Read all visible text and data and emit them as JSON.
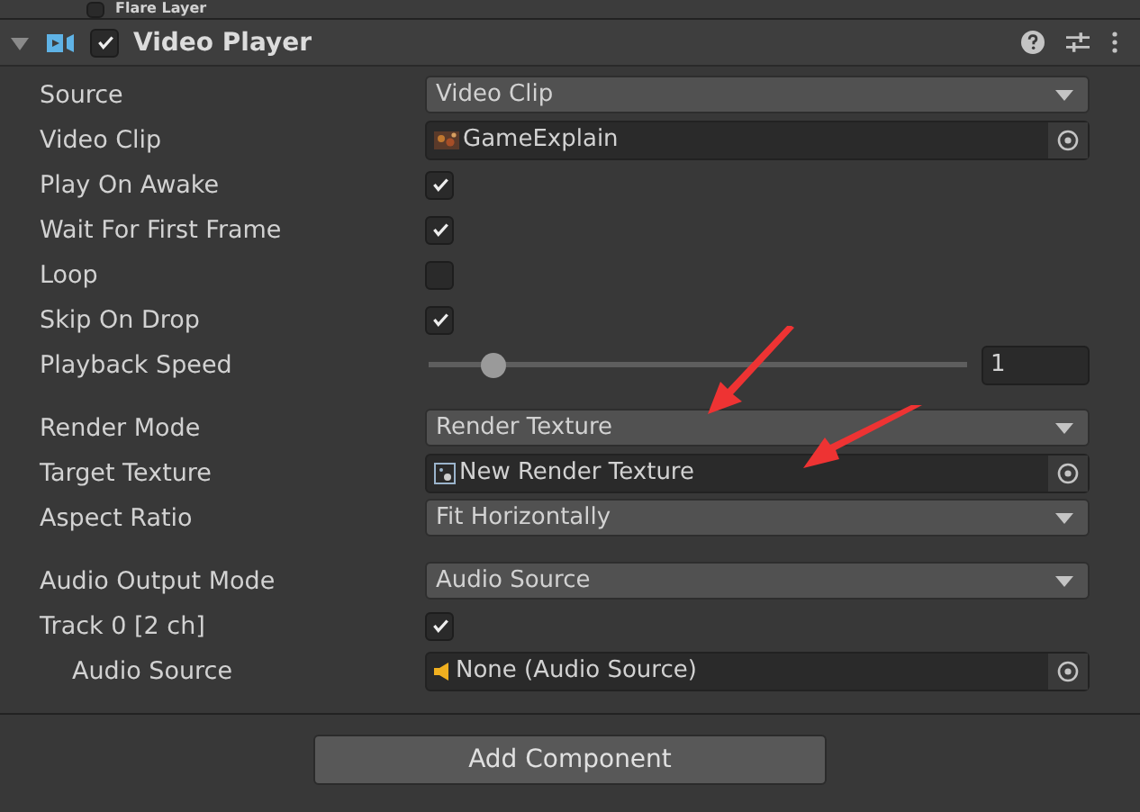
{
  "previous_component": {
    "title": "Flare Layer",
    "enabled": false
  },
  "component": {
    "title": "Video Player",
    "enabled": true,
    "expanded": true
  },
  "property_groups": [
    [
      {
        "label": "Source",
        "kind": "dropdown",
        "value": "Video Clip"
      },
      {
        "label": "Video Clip",
        "kind": "video_object",
        "value": "GameExplain"
      },
      {
        "label": "Play On Awake",
        "kind": "checkbox",
        "checked": true
      },
      {
        "label": "Wait For First Frame",
        "kind": "checkbox",
        "checked": true
      },
      {
        "label": "Loop",
        "kind": "checkbox",
        "checked": false
      },
      {
        "label": "Skip On Drop",
        "kind": "checkbox",
        "checked": true
      },
      {
        "label": "Playback Speed",
        "kind": "slider",
        "level": 0.12,
        "value": "1"
      }
    ],
    [
      {
        "label": "Render Mode",
        "kind": "dropdown",
        "value": "Render Texture"
      },
      {
        "label": "Target Texture",
        "kind": "texture_object",
        "value": "New Render Texture"
      },
      {
        "label": "Aspect Ratio",
        "kind": "dropdown",
        "value": "Fit Horizontally"
      }
    ],
    [
      {
        "label": "Audio Output Mode",
        "kind": "dropdown",
        "value": "Audio Source"
      },
      {
        "label": "Track 0 [2 ch]",
        "kind": "checkbox",
        "checked": true
      },
      {
        "label": "Audio Source",
        "kind": "audio_object",
        "value": "None (Audio Source)",
        "indented": true
      }
    ]
  ],
  "add_component_button": "Add Component"
}
